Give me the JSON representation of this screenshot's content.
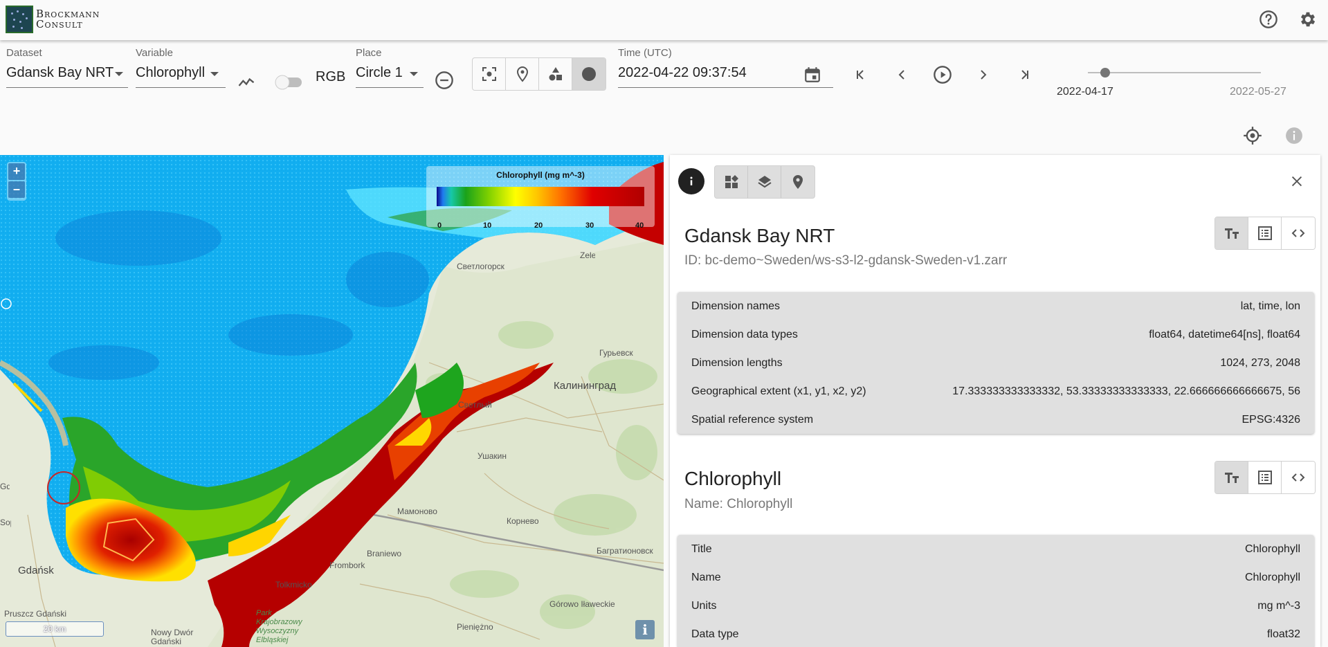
{
  "brand": {
    "line1": "Brockmann",
    "line2": "Consult"
  },
  "controls": {
    "dataset": {
      "label": "Dataset",
      "value": "Gdansk Bay NRT"
    },
    "variable": {
      "label": "Variable",
      "value": "Chlorophyll"
    },
    "rgb_label": "RGB",
    "place": {
      "label": "Place",
      "value": "Circle 1"
    },
    "time": {
      "label": "Time (UTC)",
      "value": "2022-04-22 09:37:54"
    },
    "slider": {
      "start": "2022-04-17",
      "end": "2022-05-27",
      "position_fraction": 0.1
    }
  },
  "map": {
    "zoom_in": "+",
    "zoom_out": "–",
    "legend": {
      "title": "Chlorophyll (mg m^-3)",
      "ticks": [
        "0",
        "10",
        "20",
        "30",
        "40"
      ]
    },
    "scale_label": "20 km",
    "attribution": "i",
    "labels": [
      "Светлогорск",
      "Гурьевск",
      "Калининград",
      "Светлый",
      "Ушакин",
      "Мамоново",
      "Корнево",
      "Багратионовск",
      "Braniewo",
      "Frombork",
      "Tolkmicko",
      "Park Krajobrazowy Wysoczyzny Elbląskiej",
      "Gdańsk",
      "Pruszcz Gdański",
      "Nowy Dwór Gdański",
      "Górowo Iławeckie",
      "Pieniężno",
      "Sopot",
      "Gdynia",
      "Zelenogradsk"
    ]
  },
  "panel": {
    "dataset": {
      "title": "Gdansk Bay NRT",
      "subtitle": "ID: bc-demo~Sweden/ws-s3-l2-gdansk-Sweden-v1.zarr",
      "rows": [
        {
          "key": "Dimension names",
          "value": "lat, time, lon"
        },
        {
          "key": "Dimension data types",
          "value": "float64, datetime64[ns], float64"
        },
        {
          "key": "Dimension lengths",
          "value": "1024, 273, 2048"
        },
        {
          "key": "Geographical extent (x1, y1, x2, y2)",
          "value": "17.333333333333332, 53.33333333333333, 22.666666666666675, 56"
        },
        {
          "key": "Spatial reference system",
          "value": "EPSG:4326"
        }
      ]
    },
    "variable": {
      "title": "Chlorophyll",
      "subtitle": "Name: Chlorophyll",
      "rows": [
        {
          "key": "Title",
          "value": "Chlorophyll"
        },
        {
          "key": "Name",
          "value": "Chlorophyll"
        },
        {
          "key": "Units",
          "value": "mg m^-3"
        },
        {
          "key": "Data type",
          "value": "float32"
        }
      ]
    }
  }
}
